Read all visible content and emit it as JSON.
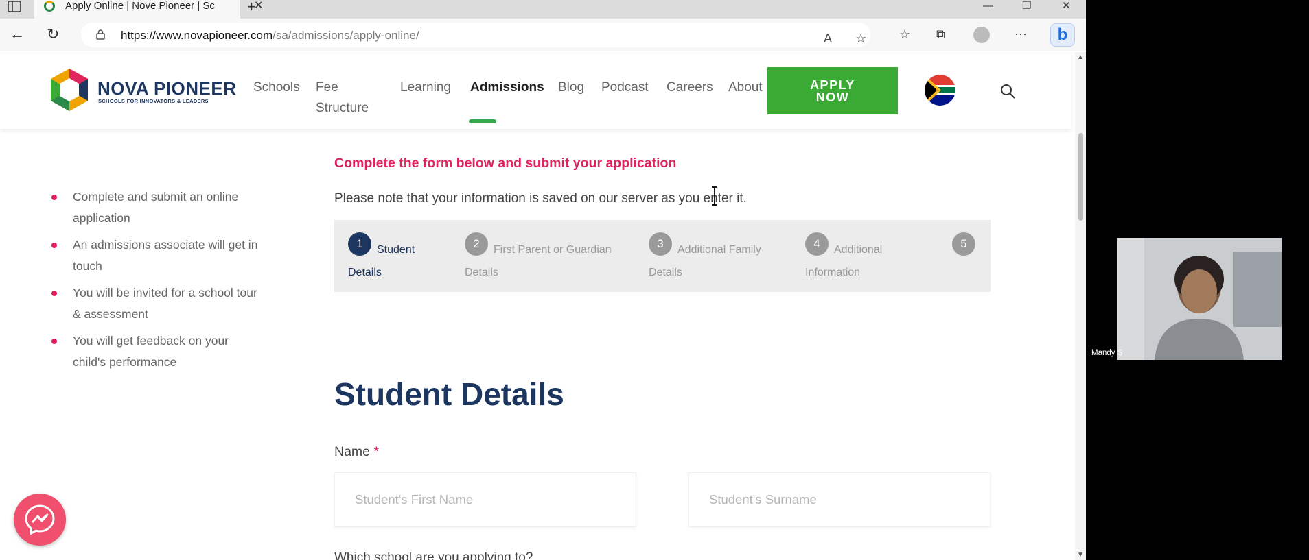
{
  "browser": {
    "tab_title": "Apply Online | Nove Pioneer | Sc",
    "url_host": "https://www.novapioneer.com",
    "url_path": "/sa/admissions/apply-online/"
  },
  "site": {
    "logo_name": "NOVA PIONEER",
    "logo_tagline": "SCHOOLS FOR INNOVATORS & LEADERS",
    "nav": {
      "schools": "Schools",
      "fee_line1": "Fee",
      "fee_line2": "Structure",
      "learning": "Learning",
      "admissions": "Admissions",
      "blog": "Blog",
      "podcast": "Podcast",
      "careers": "Careers",
      "about": "About"
    },
    "apply_line1": "APPLY",
    "apply_line2": "NOW"
  },
  "sidebar": {
    "bullets": [
      "Complete and submit an online application",
      "An admissions associate will get in touch",
      "You will be invited for a school tour & assessment",
      "You will get feedback on your child's performance"
    ]
  },
  "form": {
    "heading": "Complete the form below and submit your application",
    "note": "Please note that your information is saved on our server as you enter it.",
    "steps": [
      {
        "num": "1",
        "label": "Student Details"
      },
      {
        "num": "2",
        "label": "First Parent or Guardian Details"
      },
      {
        "num": "3",
        "label": "Additional Family Details"
      },
      {
        "num": "4",
        "label": "Additional Information"
      },
      {
        "num": "5",
        "label": ""
      }
    ],
    "active_step": 1,
    "section_title": "Student Details",
    "name_label": "Name",
    "required_mark": "*",
    "first_name_placeholder": "Student's First Name",
    "surname_placeholder": "Student's Surname",
    "next_label_partial": "Which school are you applying to?"
  },
  "video_call": {
    "participant_name": "Mandy S"
  },
  "colors": {
    "brand_navy": "#1d3660",
    "accent_pink": "#e0245e",
    "apply_green": "#3aaa35",
    "nav_underline": "#34a853"
  }
}
